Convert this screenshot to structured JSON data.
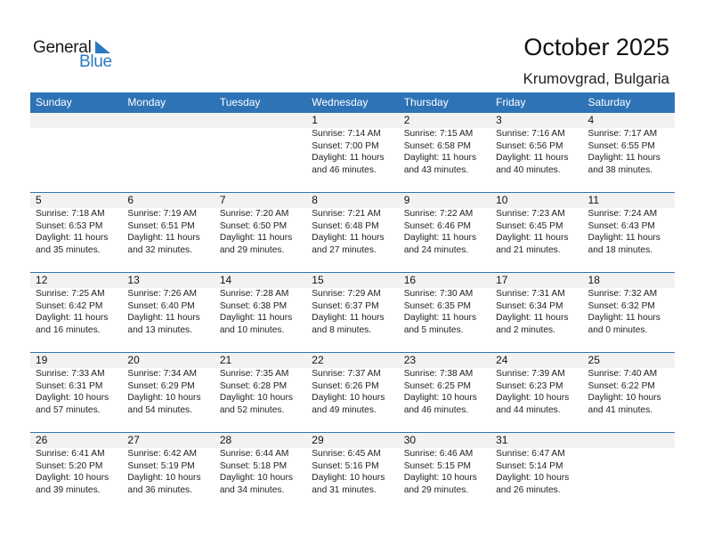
{
  "logo": {
    "general": "General",
    "blue": "Blue"
  },
  "header": {
    "title": "October 2025",
    "location": "Krumovgrad, Bulgaria"
  },
  "colors": {
    "accent": "#2e73b6",
    "daynum_bg": "#f2f2f2",
    "logo_blue": "#2b7ac1"
  },
  "weekdays": [
    "Sunday",
    "Monday",
    "Tuesday",
    "Wednesday",
    "Thursday",
    "Friday",
    "Saturday"
  ],
  "weeks": [
    [
      {
        "day": "",
        "sunrise": "",
        "sunset": "",
        "daylight": "",
        "daylight2": ""
      },
      {
        "day": "",
        "sunrise": "",
        "sunset": "",
        "daylight": "",
        "daylight2": ""
      },
      {
        "day": "",
        "sunrise": "",
        "sunset": "",
        "daylight": "",
        "daylight2": ""
      },
      {
        "day": "1",
        "sunrise": "Sunrise: 7:14 AM",
        "sunset": "Sunset: 7:00 PM",
        "daylight": "Daylight: 11 hours",
        "daylight2": "and 46 minutes."
      },
      {
        "day": "2",
        "sunrise": "Sunrise: 7:15 AM",
        "sunset": "Sunset: 6:58 PM",
        "daylight": "Daylight: 11 hours",
        "daylight2": "and 43 minutes."
      },
      {
        "day": "3",
        "sunrise": "Sunrise: 7:16 AM",
        "sunset": "Sunset: 6:56 PM",
        "daylight": "Daylight: 11 hours",
        "daylight2": "and 40 minutes."
      },
      {
        "day": "4",
        "sunrise": "Sunrise: 7:17 AM",
        "sunset": "Sunset: 6:55 PM",
        "daylight": "Daylight: 11 hours",
        "daylight2": "and 38 minutes."
      }
    ],
    [
      {
        "day": "5",
        "sunrise": "Sunrise: 7:18 AM",
        "sunset": "Sunset: 6:53 PM",
        "daylight": "Daylight: 11 hours",
        "daylight2": "and 35 minutes."
      },
      {
        "day": "6",
        "sunrise": "Sunrise: 7:19 AM",
        "sunset": "Sunset: 6:51 PM",
        "daylight": "Daylight: 11 hours",
        "daylight2": "and 32 minutes."
      },
      {
        "day": "7",
        "sunrise": "Sunrise: 7:20 AM",
        "sunset": "Sunset: 6:50 PM",
        "daylight": "Daylight: 11 hours",
        "daylight2": "and 29 minutes."
      },
      {
        "day": "8",
        "sunrise": "Sunrise: 7:21 AM",
        "sunset": "Sunset: 6:48 PM",
        "daylight": "Daylight: 11 hours",
        "daylight2": "and 27 minutes."
      },
      {
        "day": "9",
        "sunrise": "Sunrise: 7:22 AM",
        "sunset": "Sunset: 6:46 PM",
        "daylight": "Daylight: 11 hours",
        "daylight2": "and 24 minutes."
      },
      {
        "day": "10",
        "sunrise": "Sunrise: 7:23 AM",
        "sunset": "Sunset: 6:45 PM",
        "daylight": "Daylight: 11 hours",
        "daylight2": "and 21 minutes."
      },
      {
        "day": "11",
        "sunrise": "Sunrise: 7:24 AM",
        "sunset": "Sunset: 6:43 PM",
        "daylight": "Daylight: 11 hours",
        "daylight2": "and 18 minutes."
      }
    ],
    [
      {
        "day": "12",
        "sunrise": "Sunrise: 7:25 AM",
        "sunset": "Sunset: 6:42 PM",
        "daylight": "Daylight: 11 hours",
        "daylight2": "and 16 minutes."
      },
      {
        "day": "13",
        "sunrise": "Sunrise: 7:26 AM",
        "sunset": "Sunset: 6:40 PM",
        "daylight": "Daylight: 11 hours",
        "daylight2": "and 13 minutes."
      },
      {
        "day": "14",
        "sunrise": "Sunrise: 7:28 AM",
        "sunset": "Sunset: 6:38 PM",
        "daylight": "Daylight: 11 hours",
        "daylight2": "and 10 minutes."
      },
      {
        "day": "15",
        "sunrise": "Sunrise: 7:29 AM",
        "sunset": "Sunset: 6:37 PM",
        "daylight": "Daylight: 11 hours",
        "daylight2": "and 8 minutes."
      },
      {
        "day": "16",
        "sunrise": "Sunrise: 7:30 AM",
        "sunset": "Sunset: 6:35 PM",
        "daylight": "Daylight: 11 hours",
        "daylight2": "and 5 minutes."
      },
      {
        "day": "17",
        "sunrise": "Sunrise: 7:31 AM",
        "sunset": "Sunset: 6:34 PM",
        "daylight": "Daylight: 11 hours",
        "daylight2": "and 2 minutes."
      },
      {
        "day": "18",
        "sunrise": "Sunrise: 7:32 AM",
        "sunset": "Sunset: 6:32 PM",
        "daylight": "Daylight: 11 hours",
        "daylight2": "and 0 minutes."
      }
    ],
    [
      {
        "day": "19",
        "sunrise": "Sunrise: 7:33 AM",
        "sunset": "Sunset: 6:31 PM",
        "daylight": "Daylight: 10 hours",
        "daylight2": "and 57 minutes."
      },
      {
        "day": "20",
        "sunrise": "Sunrise: 7:34 AM",
        "sunset": "Sunset: 6:29 PM",
        "daylight": "Daylight: 10 hours",
        "daylight2": "and 54 minutes."
      },
      {
        "day": "21",
        "sunrise": "Sunrise: 7:35 AM",
        "sunset": "Sunset: 6:28 PM",
        "daylight": "Daylight: 10 hours",
        "daylight2": "and 52 minutes."
      },
      {
        "day": "22",
        "sunrise": "Sunrise: 7:37 AM",
        "sunset": "Sunset: 6:26 PM",
        "daylight": "Daylight: 10 hours",
        "daylight2": "and 49 minutes."
      },
      {
        "day": "23",
        "sunrise": "Sunrise: 7:38 AM",
        "sunset": "Sunset: 6:25 PM",
        "daylight": "Daylight: 10 hours",
        "daylight2": "and 46 minutes."
      },
      {
        "day": "24",
        "sunrise": "Sunrise: 7:39 AM",
        "sunset": "Sunset: 6:23 PM",
        "daylight": "Daylight: 10 hours",
        "daylight2": "and 44 minutes."
      },
      {
        "day": "25",
        "sunrise": "Sunrise: 7:40 AM",
        "sunset": "Sunset: 6:22 PM",
        "daylight": "Daylight: 10 hours",
        "daylight2": "and 41 minutes."
      }
    ],
    [
      {
        "day": "26",
        "sunrise": "Sunrise: 6:41 AM",
        "sunset": "Sunset: 5:20 PM",
        "daylight": "Daylight: 10 hours",
        "daylight2": "and 39 minutes."
      },
      {
        "day": "27",
        "sunrise": "Sunrise: 6:42 AM",
        "sunset": "Sunset: 5:19 PM",
        "daylight": "Daylight: 10 hours",
        "daylight2": "and 36 minutes."
      },
      {
        "day": "28",
        "sunrise": "Sunrise: 6:44 AM",
        "sunset": "Sunset: 5:18 PM",
        "daylight": "Daylight: 10 hours",
        "daylight2": "and 34 minutes."
      },
      {
        "day": "29",
        "sunrise": "Sunrise: 6:45 AM",
        "sunset": "Sunset: 5:16 PM",
        "daylight": "Daylight: 10 hours",
        "daylight2": "and 31 minutes."
      },
      {
        "day": "30",
        "sunrise": "Sunrise: 6:46 AM",
        "sunset": "Sunset: 5:15 PM",
        "daylight": "Daylight: 10 hours",
        "daylight2": "and 29 minutes."
      },
      {
        "day": "31",
        "sunrise": "Sunrise: 6:47 AM",
        "sunset": "Sunset: 5:14 PM",
        "daylight": "Daylight: 10 hours",
        "daylight2": "and 26 minutes."
      },
      {
        "day": "",
        "sunrise": "",
        "sunset": "",
        "daylight": "",
        "daylight2": ""
      }
    ]
  ]
}
